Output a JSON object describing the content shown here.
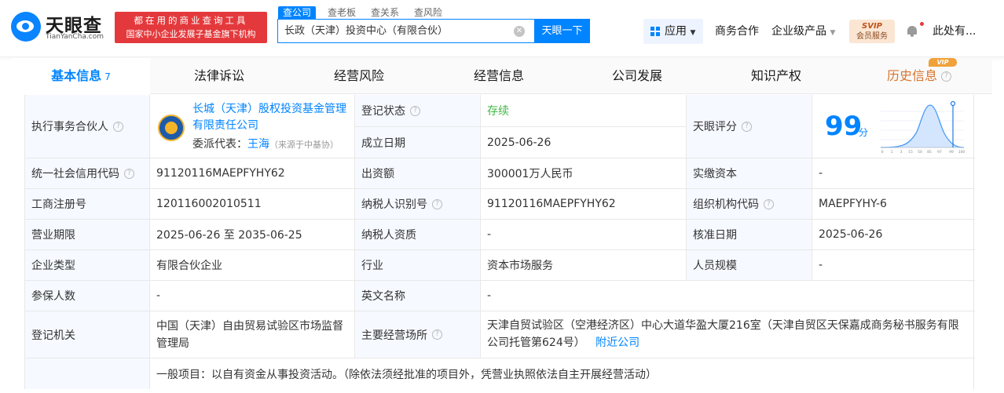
{
  "header": {
    "logo_cn": "天眼查",
    "logo_en": "TianYanCha.com",
    "slogan_line1": "都在用的商业查询工具",
    "slogan_line2": "国家中小企业发展子基金旗下机构",
    "search_tabs": [
      "查公司",
      "查老板",
      "查关系",
      "查风险"
    ],
    "search_value": "长政（天津）投资中心（有限合伙）",
    "search_button": "天眼一下",
    "nav_app": "应用",
    "nav_business": "商务合作",
    "nav_enterprise": "企业级产品",
    "vip_line1": "SVIP",
    "vip_line2": "会员服务",
    "user_name": "此处有..."
  },
  "tabs": {
    "basic": "基本信息",
    "basic_count": "7",
    "legal": "法律诉讼",
    "risk": "经营风险",
    "operation": "经营信息",
    "development": "公司发展",
    "ip": "知识产权",
    "history": "历史信息",
    "vip": "VIP"
  },
  "info": {
    "partner_label": "执行事务合伙人",
    "partner_name": "长城（天津）股权投资基金管理有限责任公司",
    "rep_label": "委派代表：",
    "rep_name": "王海",
    "rep_note": "（来源于中基协）",
    "reg_status_label": "登记状态",
    "reg_status": "存续",
    "found_date_label": "成立日期",
    "found_date": "2025-06-26",
    "score_label": "天眼评分",
    "score": "99",
    "score_unit": "分",
    "score_axis": [
      "0",
      "1",
      "3",
      "15",
      "50",
      "85",
      "97",
      "99",
      "100"
    ],
    "credit_code_label": "统一社会信用代码",
    "credit_code": "91120116MAEPFYHY62",
    "capital_label": "出资额",
    "capital": "300001万人民币",
    "paid_capital_label": "实缴资本",
    "paid_capital": "-",
    "reg_no_label": "工商注册号",
    "reg_no": "120116002010511",
    "tax_id_label": "纳税人识别号",
    "tax_id": "91120116MAEPFYHY62",
    "org_code_label": "组织机构代码",
    "org_code": "MAEPFYHY-6",
    "term_label": "营业期限",
    "term": "2025-06-26 至 2035-06-25",
    "tax_qual_label": "纳税人资质",
    "tax_qual": "-",
    "approve_date_label": "核准日期",
    "approve_date": "2025-06-26",
    "type_label": "企业类型",
    "type": "有限合伙企业",
    "industry_label": "行业",
    "industry": "资本市场服务",
    "staff_label": "人员规模",
    "staff": "-",
    "insured_label": "参保人数",
    "insured": "-",
    "en_name_label": "英文名称",
    "en_name": "-",
    "authority_label": "登记机关",
    "authority": "中国（天津）自由贸易试验区市场监督管理局",
    "address_label": "主要经营场所",
    "address": "天津自贸试验区（空港经济区）中心大道华盈大厦216室（天津自贸区天保嘉成商务秘书服务有限公司托管第624号）",
    "nearby": "附近公司",
    "scope": "一般项目：以自有资金从事投资活动。（除依法须经批准的项目外，凭营业执照依法自主开展经营活动）"
  }
}
